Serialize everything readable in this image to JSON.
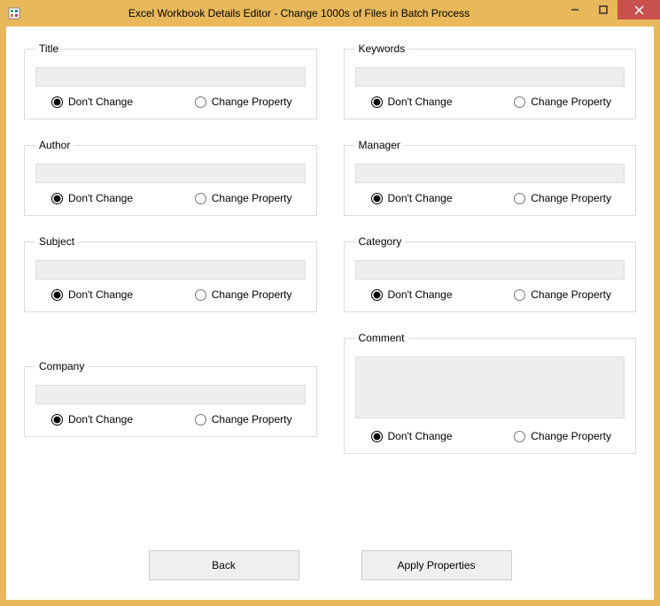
{
  "window": {
    "title": "Excel Workbook Details Editor - Change 1000s of Files in Batch Process"
  },
  "groups": {
    "title": {
      "legend": "Title",
      "value": "",
      "dont": "Don't Change",
      "change": "Change Property"
    },
    "author": {
      "legend": "Author",
      "value": "",
      "dont": "Don't Change",
      "change": "Change Property"
    },
    "subject": {
      "legend": "Subject",
      "value": "",
      "dont": "Don't Change",
      "change": "Change Property"
    },
    "company": {
      "legend": "Company",
      "value": "",
      "dont": "Don't Change",
      "change": "Change Property"
    },
    "keywords": {
      "legend": "Keywords",
      "value": "",
      "dont": "Don't Change",
      "change": "Change Property"
    },
    "manager": {
      "legend": "Manager",
      "value": "",
      "dont": "Don't Change",
      "change": "Change Property"
    },
    "category": {
      "legend": "Category",
      "value": "",
      "dont": "Don't Change",
      "change": "Change Property"
    },
    "comment": {
      "legend": "Comment",
      "value": "",
      "dont": "Don't Change",
      "change": "Change Property"
    }
  },
  "buttons": {
    "back": "Back",
    "apply": "Apply Properties"
  }
}
